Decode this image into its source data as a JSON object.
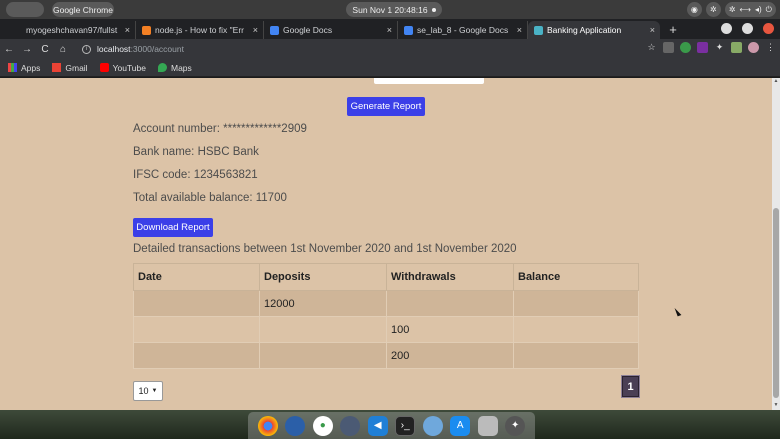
{
  "os": {
    "apple_glyph": "",
    "app_name": "Google Chrome",
    "clock": "Sun Nov 1  20:48:16"
  },
  "tabs": [
    {
      "label": "myogeshchavan97/fullst",
      "favicon_color": "#ffffff"
    },
    {
      "label": "node.js - How to fix \"Err",
      "favicon_color": "#f48024"
    },
    {
      "label": "Google Docs",
      "favicon_color": "#4285f4"
    },
    {
      "label": "se_lab_8 - Google Docs",
      "favicon_color": "#4285f4"
    },
    {
      "label": "Banking Application",
      "favicon_color": "#4ab3c6"
    }
  ],
  "address": {
    "host": "localhost",
    "path": ":3000/account"
  },
  "bookmarks": [
    {
      "label": "Apps"
    },
    {
      "label": "Gmail"
    },
    {
      "label": "YouTube"
    },
    {
      "label": "Maps"
    }
  ],
  "page": {
    "generate_label": "Generate Report",
    "account_number": "Account number: *************2909",
    "bank_name": "Bank name: HSBC Bank",
    "ifsc": "IFSC code: 1234563821",
    "balance": "Total available balance: 11700",
    "download_label": "Download Report",
    "transactions_heading": "Detailed transactions between 1st November 2020 and 1st November 2020",
    "table": {
      "headers": [
        "Date",
        "Deposits",
        "Withdrawals",
        "Balance"
      ],
      "rows": [
        [
          "",
          "12000",
          "",
          ""
        ],
        [
          "",
          "",
          "100",
          ""
        ],
        [
          "",
          "",
          "200",
          ""
        ]
      ]
    },
    "page_size": "10",
    "current_page": "1"
  },
  "colors": {
    "page_bg": "#dcc3a7",
    "button": "#3b3fe8"
  }
}
